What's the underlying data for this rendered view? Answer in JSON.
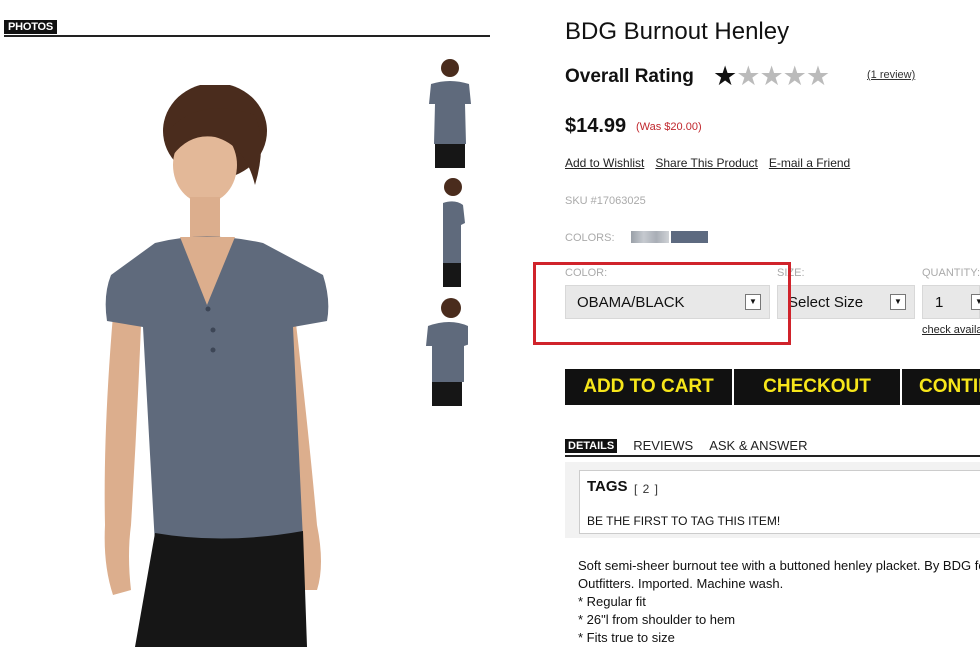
{
  "photos": {
    "label": "PHOTOS"
  },
  "product": {
    "title": "BDG Burnout Henley",
    "rating_label": "Overall Rating",
    "rating_value": 1,
    "rating_max": 5,
    "review_link": "(1 review)",
    "price": "$14.99",
    "was_price": "(Was $20.00)",
    "sku": "SKU #17063025",
    "colors_label": "COLORS:"
  },
  "links": {
    "wishlist": "Add to Wishlist",
    "share": "Share This Product",
    "email": "E-mail a Friend"
  },
  "options": {
    "color_label": "COLOR:",
    "color_value": "OBAMA/BLACK",
    "size_label": "SIZE:",
    "size_value": "Select Size",
    "quantity_label": "QUANTITY:",
    "quantity_value": "1",
    "check_availability": "check availability"
  },
  "buttons": {
    "add_to_cart": "ADD TO CART",
    "checkout": "CHECKOUT",
    "continue": "CONTINUE"
  },
  "tabs": {
    "details": "DETAILS",
    "reviews": "REVIEWS",
    "ask": "ASK & ANSWER"
  },
  "tags": {
    "title": "TAGS",
    "count": "[ 2 ]",
    "note": "BE THE FIRST TO TAG THIS ITEM!"
  },
  "description": {
    "lines": [
      "Soft semi-sheer burnout tee with a buttoned henley placket. By BDG for Urban",
      "Outfitters. Imported. Machine wash.",
      "* Regular fit",
      "* 26\"l from shoulder to hem",
      "* Fits true to size"
    ]
  },
  "colors": {
    "accent_yellow": "#f7e61a",
    "highlight_red": "#d0232b",
    "sale_red": "#c0272d",
    "swatch_light": "#c6cad0",
    "swatch_dark": "#5d6a80",
    "shirt": "#5f6a7c"
  }
}
